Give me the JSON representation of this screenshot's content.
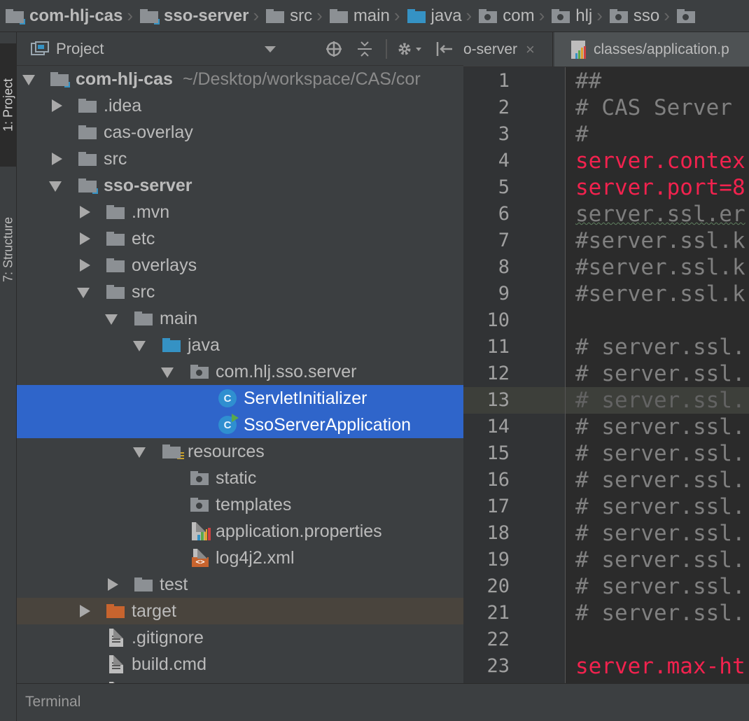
{
  "breadcrumb": [
    {
      "label": "com-hlj-cas",
      "icon": "module-folder-icon"
    },
    {
      "label": "sso-server",
      "icon": "module-folder-icon"
    },
    {
      "label": "src",
      "icon": "folder-icon"
    },
    {
      "label": "main",
      "icon": "folder-icon"
    },
    {
      "label": "java",
      "icon": "source-folder-icon"
    },
    {
      "label": "com",
      "icon": "package-icon"
    },
    {
      "label": "hlj",
      "icon": "package-icon"
    },
    {
      "label": "sso",
      "icon": "package-icon"
    }
  ],
  "toolstrip": {
    "project_tab": "1: Project",
    "structure_tab": "7: Structure"
  },
  "project_panel": {
    "title": "Project",
    "view_dropdown_icon": "dropdown-arrow-icon",
    "locate_icon": "target-icon",
    "collapse_icon": "collapse-all-icon",
    "settings_icon": "gear-icon",
    "hide_icon": "hide-panel-icon"
  },
  "tree": [
    {
      "label": "com-hlj-cas",
      "suffix": "~/Desktop/workspace/CAS/cor",
      "state": "expanded",
      "icon": "module-folder-icon"
    },
    {
      "label": ".idea",
      "state": "collapsed",
      "icon": "folder-icon"
    },
    {
      "label": "cas-overlay",
      "state": "none",
      "icon": "folder-icon"
    },
    {
      "label": "src",
      "state": "collapsed",
      "icon": "folder-icon"
    },
    {
      "label": "sso-server",
      "state": "expanded",
      "icon": "module-folder-icon"
    },
    {
      "label": ".mvn",
      "state": "collapsed",
      "icon": "folder-icon"
    },
    {
      "label": "etc",
      "state": "collapsed",
      "icon": "folder-icon"
    },
    {
      "label": "overlays",
      "state": "collapsed",
      "icon": "folder-icon"
    },
    {
      "label": "src",
      "state": "expanded",
      "icon": "folder-icon"
    },
    {
      "label": "main",
      "state": "expanded",
      "icon": "folder-icon"
    },
    {
      "label": "java",
      "state": "expanded",
      "icon": "source-folder-icon"
    },
    {
      "label": "com.hlj.sso.server",
      "state": "expanded",
      "icon": "package-icon"
    },
    {
      "label": "ServletInitializer",
      "state": "none",
      "icon": "java-class-icon",
      "selected": true
    },
    {
      "label": "SsoServerApplication",
      "state": "none",
      "icon": "spring-boot-class-icon",
      "selected": true
    },
    {
      "label": "resources",
      "state": "expanded",
      "icon": "resources-folder-icon"
    },
    {
      "label": "static",
      "state": "none",
      "icon": "package-icon"
    },
    {
      "label": "templates",
      "state": "none",
      "icon": "package-icon"
    },
    {
      "label": "application.properties",
      "state": "none",
      "icon": "properties-file-icon"
    },
    {
      "label": "log4j2.xml",
      "state": "none",
      "icon": "xml-file-icon"
    },
    {
      "label": "test",
      "state": "collapsed",
      "icon": "folder-icon"
    },
    {
      "label": "target",
      "state": "collapsed",
      "icon": "excluded-folder-icon"
    },
    {
      "label": ".gitignore",
      "state": "none",
      "icon": "text-file-icon"
    },
    {
      "label": "build.cmd",
      "state": "none",
      "icon": "text-file-icon"
    }
  ],
  "editor": {
    "tabs": [
      {
        "label": "o-server",
        "close": "×"
      },
      {
        "label": "classes/application.p",
        "close": ""
      }
    ],
    "current_line": 13,
    "lines": [
      {
        "n": "1",
        "text": "##",
        "kind": "comment"
      },
      {
        "n": "2",
        "text": "# CAS Server",
        "kind": "comment"
      },
      {
        "n": "3",
        "text": "#",
        "kind": "comment"
      },
      {
        "n": "4",
        "text": "server.contex",
        "kind": "key"
      },
      {
        "n": "5",
        "text": "server.port=8",
        "kind": "key"
      },
      {
        "n": "6",
        "text": "server.ssl.er",
        "kind": "muted"
      },
      {
        "n": "7",
        "text": "#server.ssl.k",
        "kind": "comment"
      },
      {
        "n": "8",
        "text": "#server.ssl.k",
        "kind": "comment"
      },
      {
        "n": "9",
        "text": "#server.ssl.k",
        "kind": "comment"
      },
      {
        "n": "10",
        "text": "",
        "kind": "comment"
      },
      {
        "n": "11",
        "text": "# server.ssl.",
        "kind": "comment"
      },
      {
        "n": "12",
        "text": "# server.ssl.",
        "kind": "comment"
      },
      {
        "n": "13",
        "text": "# server.ssl.",
        "kind": "current"
      },
      {
        "n": "14",
        "text": "# server.ssl.",
        "kind": "comment"
      },
      {
        "n": "15",
        "text": "# server.ssl.",
        "kind": "comment"
      },
      {
        "n": "16",
        "text": "# server.ssl.",
        "kind": "comment"
      },
      {
        "n": "17",
        "text": "# server.ssl.",
        "kind": "comment"
      },
      {
        "n": "18",
        "text": "# server.ssl.",
        "kind": "comment"
      },
      {
        "n": "19",
        "text": "# server.ssl.",
        "kind": "comment"
      },
      {
        "n": "20",
        "text": "# server.ssl.",
        "kind": "comment"
      },
      {
        "n": "21",
        "text": "# server.ssl.",
        "kind": "comment"
      },
      {
        "n": "22",
        "text": "",
        "kind": "comment"
      },
      {
        "n": "23",
        "text": "server.max-ht",
        "kind": "key"
      }
    ]
  },
  "bottombar": {
    "terminal_label": "Terminal"
  },
  "colors": {
    "selection": "#2f65ca",
    "key": "#f2224e",
    "comment": "#808080",
    "background": "#2b2b2b",
    "panel": "#3c3f41"
  }
}
